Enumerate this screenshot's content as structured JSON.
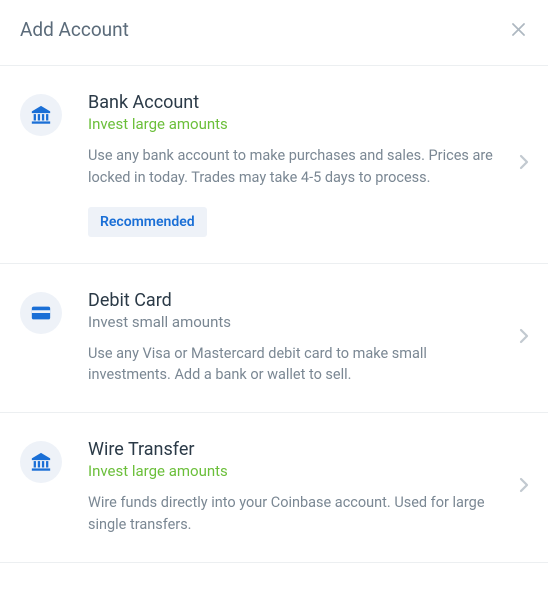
{
  "header": {
    "title": "Add Account"
  },
  "options": {
    "bank": {
      "title": "Bank Account",
      "subtitle": "Invest large amounts",
      "description": "Use any bank account to make purchases and sales. Prices are locked in today. Trades may take 4-5 days to process.",
      "badge": "Recommended"
    },
    "debit": {
      "title": "Debit Card",
      "subtitle": "Invest small amounts",
      "description": "Use any Visa or Mastercard debit card to make small investments. Add a bank or wallet to sell."
    },
    "wire": {
      "title": "Wire Transfer",
      "subtitle": "Invest large amounts",
      "description": "Wire funds directly into your Coinbase account. Used for large single transfers."
    }
  }
}
